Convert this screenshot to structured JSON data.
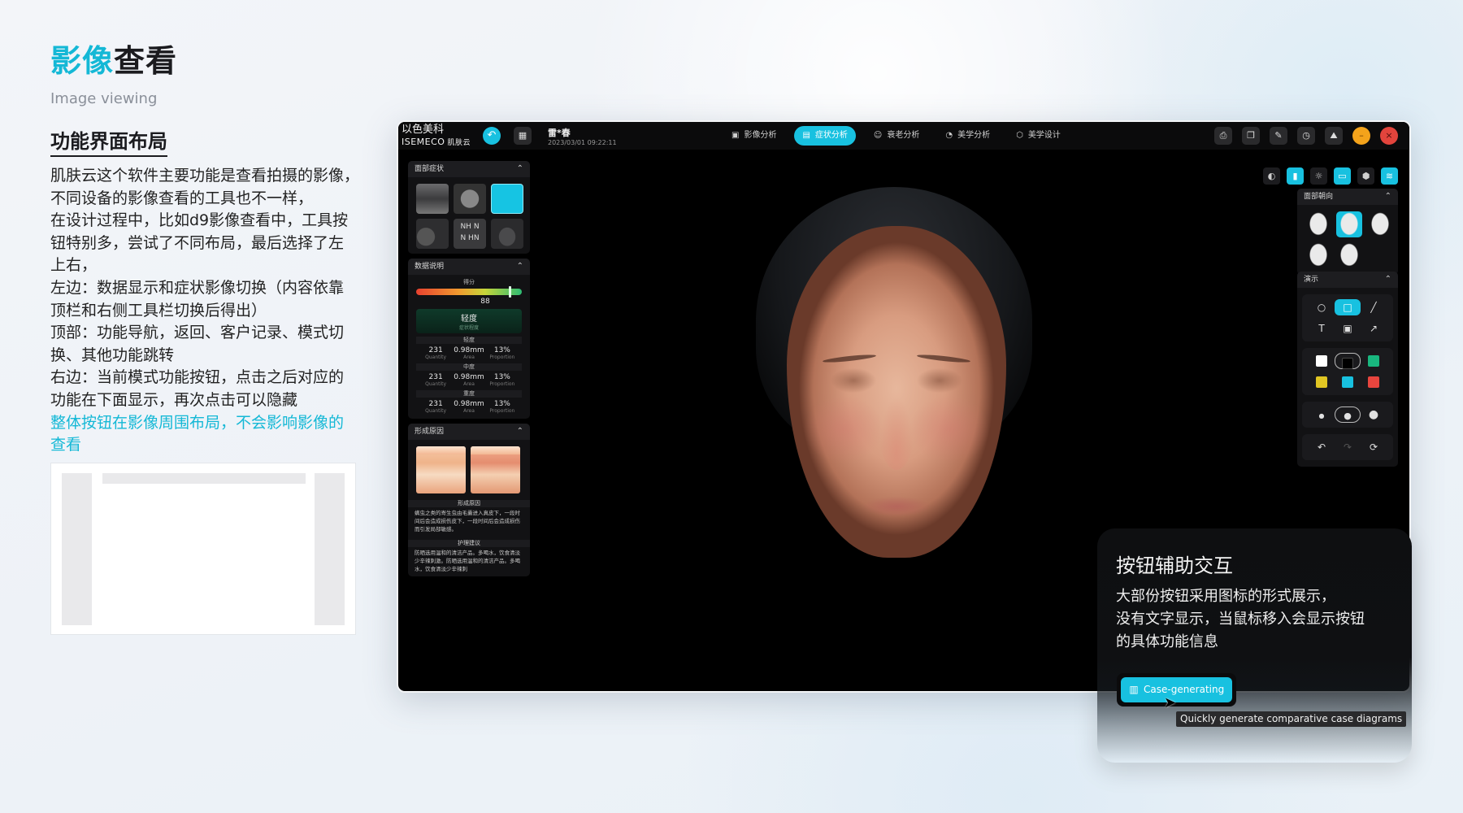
{
  "intro": {
    "title_accent": "影像",
    "title_rest": "查看",
    "subtitle": "Image viewing",
    "section": "功能界面布局",
    "lines": [
      "肌肤云这个软件主要功能是查看拍摄的影像，",
      "不同设备的影像查看的工具也不一样，",
      "在设计过程中，比如d9影像查看中，工具按",
      "钮特别多，尝试了不同布局，最后选择了左",
      "上右，",
      "左边：数据显示和症状影像切换（内容依靠",
      "顶栏和右侧工具栏切换后得出）",
      "顶部：功能导航，返回、客户记录、模式切",
      "换、其他功能跳转",
      "右边：当前模式功能按钮，点击之后对应的",
      "功能在下面显示，再次点击可以隐藏"
    ],
    "highlight_lines": [
      "整体按钮在影像周围布局，不会影响影像的",
      "查看"
    ]
  },
  "app": {
    "logo_line1": "以色美科",
    "logo_line2": "ISEMECO",
    "logo_sub": "肌肤云",
    "customer_name": "雷*春",
    "customer_time": "2023/03/01 09:22:11",
    "nav": [
      {
        "label": "影像分析",
        "icon": "image-icon",
        "active": false
      },
      {
        "label": "症状分析",
        "icon": "symptom-icon",
        "active": true
      },
      {
        "label": "衰老分析",
        "icon": "aging-icon",
        "active": false
      },
      {
        "label": "美学分析",
        "icon": "aesthetic-icon",
        "active": false
      },
      {
        "label": "美学设计",
        "icon": "design-icon",
        "active": false
      }
    ],
    "left": {
      "facial_symptoms": "面部症状",
      "thumb_texts": [
        "NH N",
        "N HN"
      ],
      "data_desc": "数据说明",
      "score_label": "得分",
      "score_value": "88",
      "score_fraction": 0.88,
      "level": "轻度",
      "level_sub": "症状程度",
      "stats": [
        {
          "title": "轻度",
          "quantity": "231",
          "area": "0.98mm",
          "proportion": "13%"
        },
        {
          "title": "中度",
          "quantity": "231",
          "area": "0.98mm",
          "proportion": "13%"
        },
        {
          "title": "重度",
          "quantity": "231",
          "area": "0.98mm",
          "proportion": "13%"
        }
      ],
      "stat_keys": {
        "quantity": "Quantity",
        "area": "Area",
        "proportion": "Proportion"
      },
      "cause_title": "形成原因",
      "cause_sub": "形成原因",
      "cause_text": "螨虫之类的寄生虫由毛囊进入真皮下，一段时间后会造成损伤皮下，一段时间后会造成损伤而引发局部敏感。",
      "care_title": "护理建议",
      "care_text": "防晒选用温和的清洁产品。多喝水，饮食清淡少辛辣刺激。防晒选用温和的清洁产品。多喝水，饮食清淡少辛辣刺"
    },
    "right": {
      "face_orientation": "面部朝向",
      "demo": "演示",
      "colors": [
        "#ffffff",
        "#000000",
        "#19b77f",
        "#e1c623",
        "#18c1e0",
        "#e8453e"
      ]
    }
  },
  "assist": {
    "title": "按钮辅助交互",
    "lines": [
      "大部份按钮采用图标的形式展示，",
      "没有文字显示，当鼠标移入会显示按钮",
      "的具体功能信息"
    ],
    "button_label": "Case-generating",
    "tooltip": "Quickly generate comparative case diagrams"
  }
}
